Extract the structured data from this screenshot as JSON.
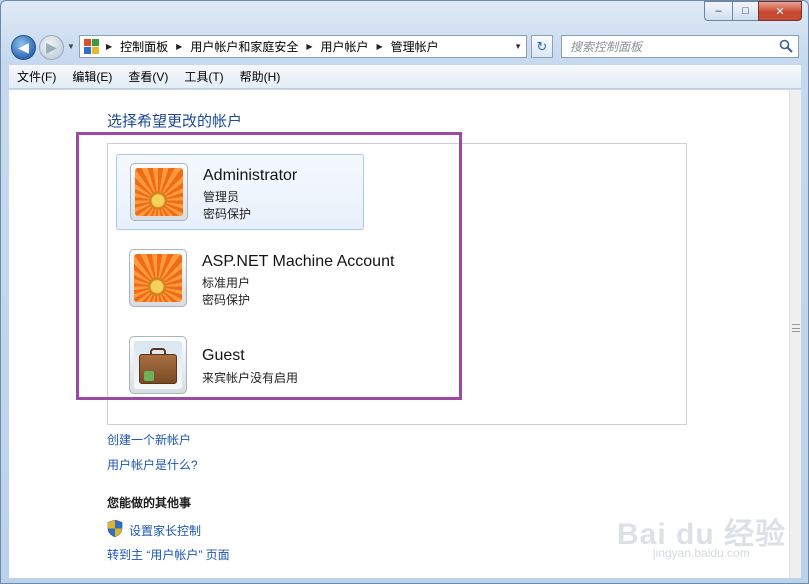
{
  "window": {
    "title": ""
  },
  "titlebar": {
    "minimize_label": "–",
    "maximize_label": "□",
    "close_label": "✕"
  },
  "nav": {
    "back_label": "◀",
    "forward_label": "▶",
    "history_dropdown": "▼"
  },
  "address": {
    "breadcrumbs": [
      "控制面板",
      "用户帐户和家庭安全",
      "用户帐户",
      "管理帐户"
    ],
    "separator": "▶",
    "dropdown": "▼"
  },
  "refresh_label": "↻",
  "search": {
    "placeholder": "搜索控制面板"
  },
  "menu": [
    "文件(F)",
    "编辑(E)",
    "查看(V)",
    "工具(T)",
    "帮助(H)"
  ],
  "main": {
    "heading": "选择希望更改的帐户",
    "accounts": [
      {
        "name": "Administrator",
        "type": "管理员",
        "status": "密码保护",
        "icon": "sunflower-picture",
        "selected": true
      },
      {
        "name": "ASP.NET Machine Account",
        "type": "标准用户",
        "status": "密码保护",
        "icon": "sunflower-picture",
        "selected": false
      },
      {
        "name": "Guest",
        "type": "来宾帐户没有启用",
        "status": "",
        "icon": "briefcase-picture",
        "selected": false
      }
    ],
    "links": {
      "create_account": "创建一个新帐户",
      "what_is_account": "用户帐户是什么?"
    },
    "other": {
      "title": "您能做的其他事",
      "parental_controls": "设置家长控制",
      "goto_main": "转到主 “用户帐户” 页面"
    }
  },
  "watermark": {
    "main": "Bai du 经验",
    "sub": "jingyan.baidu.com"
  },
  "colors": {
    "link": "#1c55b4",
    "heading": "#1e4a94",
    "highlight": "#9a4aa2",
    "selection": "#e7f0fb"
  }
}
